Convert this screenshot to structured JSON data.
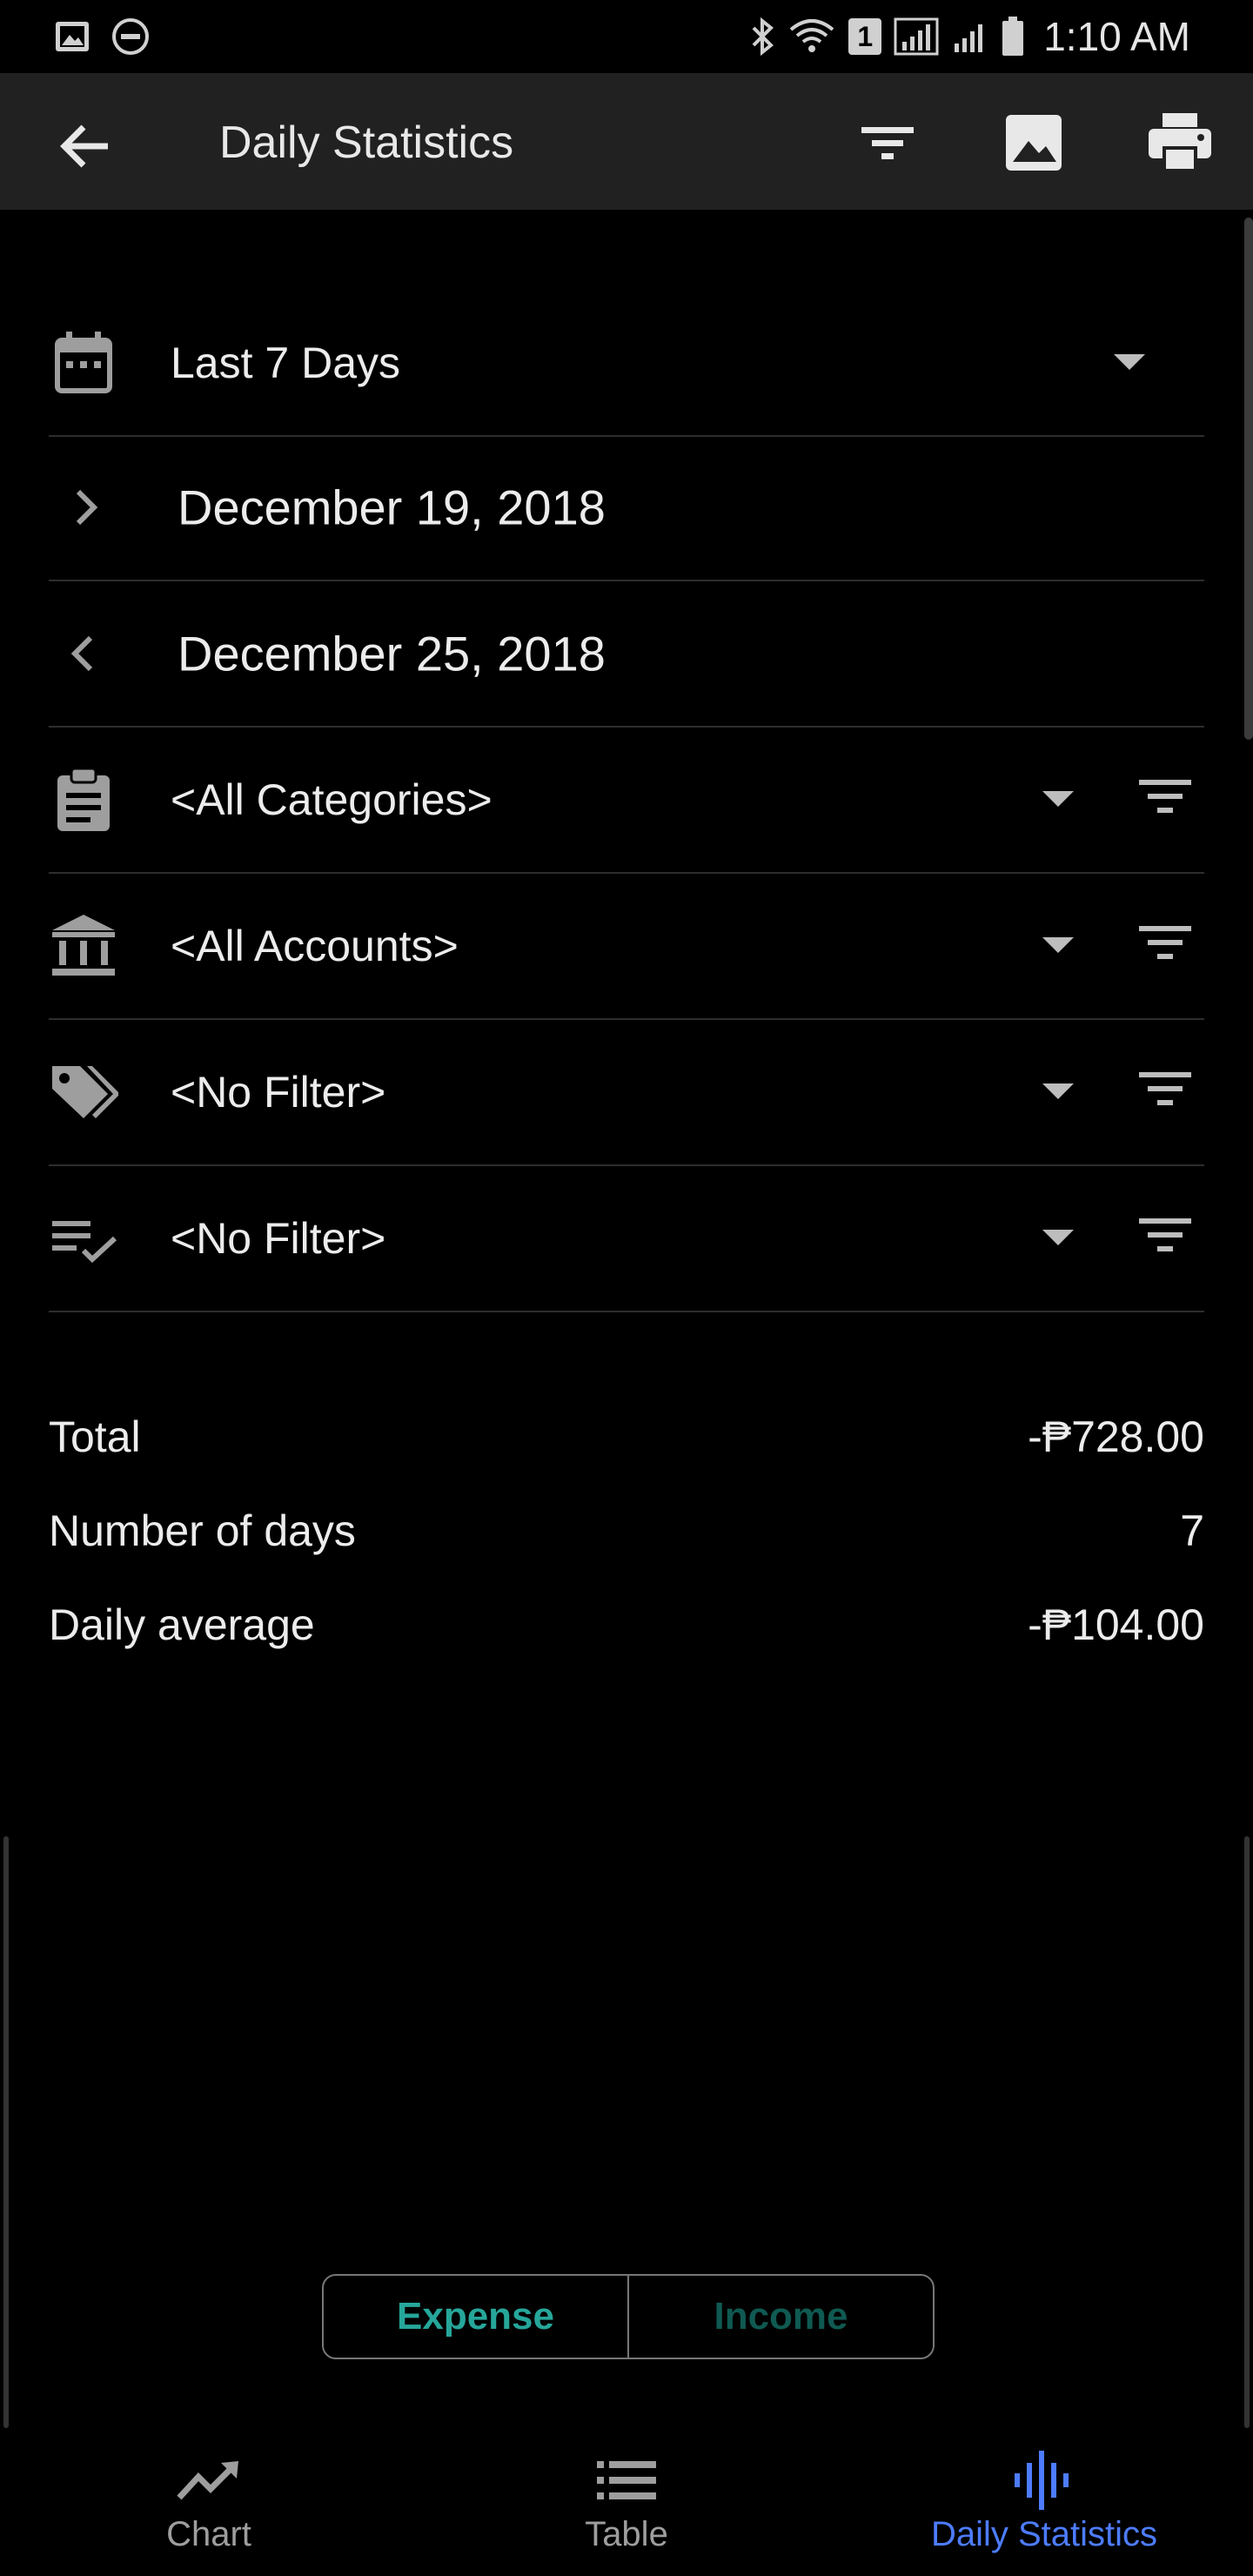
{
  "status_bar": {
    "time": "1:10 AM",
    "sim_badge": "1"
  },
  "app_bar": {
    "title": "Daily Statistics"
  },
  "filters": {
    "period": "Last 7 Days",
    "start_date": "December 19, 2018",
    "end_date": "December 25, 2018",
    "category": "<All Categories>",
    "account": "<All Accounts>",
    "tag": "<No Filter>",
    "status": "<No Filter>"
  },
  "summary": {
    "total_label": "Total",
    "total_value": "-₱728.00",
    "days_label": "Number of days",
    "days_value": "7",
    "avg_label": "Daily average",
    "avg_value": "-₱104.00"
  },
  "toggle": {
    "expense": "Expense",
    "income": "Income"
  },
  "bottom_nav": {
    "chart": "Chart",
    "table": "Table",
    "daily": "Daily Statistics"
  },
  "colors": {
    "accent": "#26a69a",
    "nav_active": "#4d7cff",
    "icon_gray": "#9e9e9e"
  }
}
